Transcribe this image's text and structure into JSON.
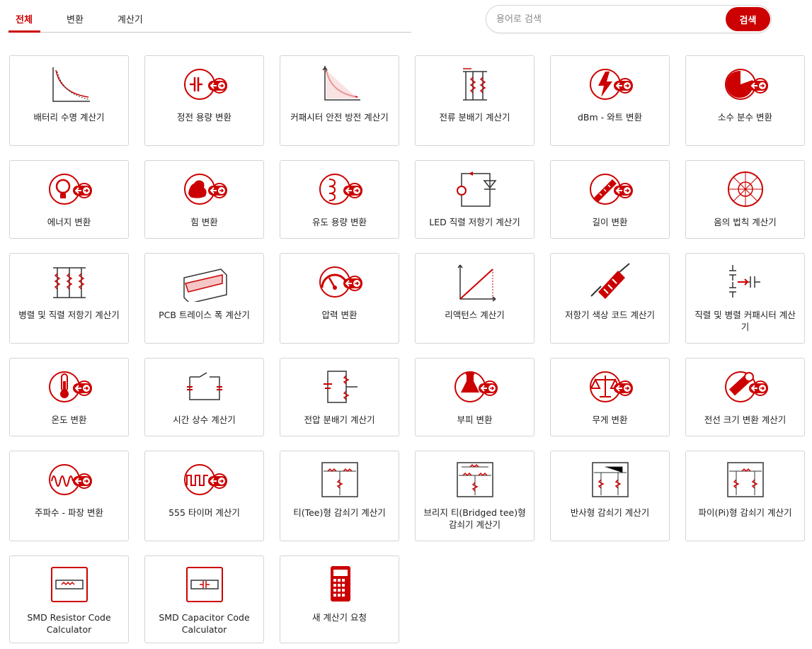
{
  "tabs": [
    {
      "label": "전체",
      "active": true
    },
    {
      "label": "변환",
      "active": false
    },
    {
      "label": "계산기",
      "active": false
    }
  ],
  "search": {
    "placeholder": "용어로 검색",
    "value": "",
    "button_label": "검색"
  },
  "accent_color": "#cc0000",
  "cards": [
    {
      "label": "배터리 수명 계산기",
      "icon": "battery-curve-icon"
    },
    {
      "label": "정전 용량 변환",
      "icon": "capacitor-convert-icon"
    },
    {
      "label": "커패시터 안전 방전 계산기",
      "icon": "discharge-curve-icon"
    },
    {
      "label": "전류 분배기 계산기",
      "icon": "current-divider-icon"
    },
    {
      "label": "dBm - 와트 변환",
      "icon": "lightning-convert-icon"
    },
    {
      "label": "소수 분수 변환",
      "icon": "pie-convert-icon"
    },
    {
      "label": "에너지 변환",
      "icon": "bulb-convert-icon"
    },
    {
      "label": "힘 변환",
      "icon": "muscle-convert-icon"
    },
    {
      "label": "유도 용량 변환",
      "icon": "coil-convert-icon"
    },
    {
      "label": "LED 직렬 저항기 계산기",
      "icon": "led-circuit-icon"
    },
    {
      "label": "길이 변환",
      "icon": "ruler-convert-icon"
    },
    {
      "label": "옴의 법칙 계산기",
      "icon": "ohms-wheel-icon"
    },
    {
      "label": "병렬 및 직렬 저항기 계산기",
      "icon": "resistor-network-icon"
    },
    {
      "label": "PCB 트레이스 폭 계산기",
      "icon": "pcb-trace-icon"
    },
    {
      "label": "압력 변환",
      "icon": "gauge-convert-icon"
    },
    {
      "label": "리액턴스 계산기",
      "icon": "reactance-graph-icon"
    },
    {
      "label": "저항기 색상 코드 계산기",
      "icon": "resistor-color-icon"
    },
    {
      "label": "직렬 및 병렬 커패시터 계산기",
      "icon": "capacitor-series-icon"
    },
    {
      "label": "온도 변환",
      "icon": "thermometer-convert-icon"
    },
    {
      "label": "시간 상수 계산기",
      "icon": "rc-circuit-icon"
    },
    {
      "label": "전압 분배기 계산기",
      "icon": "voltage-divider-icon"
    },
    {
      "label": "부피 변환",
      "icon": "flask-convert-icon"
    },
    {
      "label": "무게 변환",
      "icon": "scale-convert-icon"
    },
    {
      "label": "전선 크기 변환 계산기",
      "icon": "wire-convert-icon"
    },
    {
      "label": "주파수 - 파장 변환",
      "icon": "wave-convert-icon"
    },
    {
      "label": "555 타이머 계산기",
      "icon": "square-wave-convert-icon"
    },
    {
      "label": "티(Tee)형 감쇠기 계산기",
      "icon": "tee-attenuator-icon"
    },
    {
      "label": "브리지 티(Bridged tee)형 감쇠기 계산기",
      "icon": "bridged-tee-attenuator-icon"
    },
    {
      "label": "반사형 감쇠기 계산기",
      "icon": "reflection-attenuator-icon"
    },
    {
      "label": "파이(Pi)형 감쇠기 계산기",
      "icon": "pi-attenuator-icon"
    },
    {
      "label": "SMD Resistor Code Calculator",
      "icon": "smd-resistor-icon"
    },
    {
      "label": "SMD Capacitor Code Calculator",
      "icon": "smd-capacitor-icon"
    },
    {
      "label": "새 계산기 요청",
      "icon": "calculator-icon"
    }
  ]
}
